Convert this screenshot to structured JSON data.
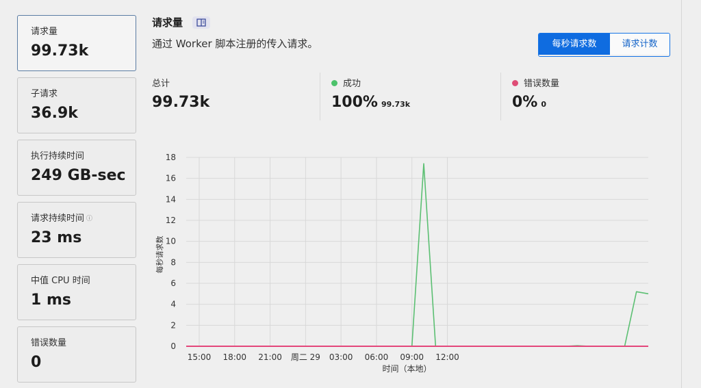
{
  "sidebar": {
    "cards": [
      {
        "label": "请求量",
        "value": "99.73k",
        "active": true
      },
      {
        "label": "子请求",
        "value": "36.9k"
      },
      {
        "label": "执行持续时间",
        "value": "249 GB-sec"
      },
      {
        "label": "请求持续时间",
        "value": "23 ms",
        "info": "ⓘ"
      },
      {
        "label": "中值 CPU 时间",
        "value": "1 ms"
      },
      {
        "label": "错误数量",
        "value": "0"
      }
    ]
  },
  "main": {
    "title": "请求量",
    "subtitle": "通过 Worker 脚本注册的传入请求。",
    "toggle": {
      "per_second": "每秒请求数",
      "count": "请求计数",
      "selected": "per_second"
    }
  },
  "stats": {
    "total": {
      "label": "总计",
      "value": "99.73k"
    },
    "success": {
      "label": "成功",
      "value": "100%",
      "sub": "99.73k",
      "color": "#4cc26b"
    },
    "errors": {
      "label": "错误数量",
      "value": "0%",
      "sub": "0",
      "color": "#de4d76"
    }
  },
  "chart_data": {
    "type": "line",
    "xlabel": "时间（本地）",
    "ylabel": "每秒请求数",
    "ylim": [
      0,
      18
    ],
    "yticks": [
      "0",
      "2",
      "4",
      "6",
      "8",
      "10",
      "12",
      "14",
      "16",
      "18"
    ],
    "xticks": [
      "15:00",
      "18:00",
      "21:00",
      "周二 29",
      "03:00",
      "06:00",
      "09:00",
      "12:00"
    ],
    "grid": true,
    "series": [
      {
        "name": "成功",
        "color": "#5bbf72",
        "points": [
          [
            -1.1,
            0
          ],
          [
            18.0,
            0
          ],
          [
            19.0,
            17.4
          ],
          [
            20.0,
            0
          ],
          [
            31.0,
            0
          ],
          [
            32.0,
            0.05
          ],
          [
            33.0,
            0
          ],
          [
            36.0,
            0
          ],
          [
            37.0,
            5.2
          ],
          [
            38.0,
            5.0
          ]
        ]
      },
      {
        "name": "错误数量",
        "color": "#e4467a",
        "points": [
          [
            -1.1,
            0
          ],
          [
            38.0,
            0
          ]
        ]
      }
    ]
  }
}
